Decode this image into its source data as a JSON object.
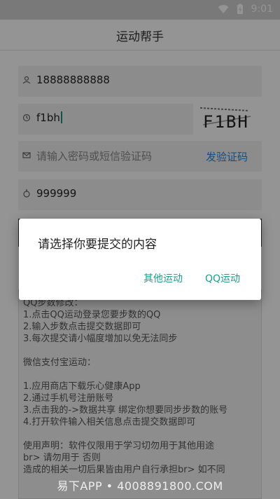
{
  "status_bar": {
    "time": "9:01"
  },
  "app_bar": {
    "title": "运动帮手"
  },
  "form": {
    "phone_value": "18888888888",
    "captcha_input_value": "f1bh",
    "captcha_image_text": "F1BH",
    "password_placeholder": "请输入密码或短信验证码",
    "send_code_label": "发验证码",
    "steps_value": "999999"
  },
  "info": {
    "lines": [
      "QQ步数修改：",
      "1.点击QQ运动登录您要步数的QQ",
      "2.输入步数点击提交数据即可",
      "3.每次提交请小幅度增加以免无法同步",
      "",
      "微信支付宝运动：",
      "",
      "1.应用商店下载乐心健康App",
      "2.通过手机号注册账号",
      "3.点击我的->数据共享 绑定你想要同步步数的账号",
      "4.打开软件输入相关信息点击提交数据即可",
      "",
      "使用声明：软件仅限用于学习切勿用于其他用途",
      "br> 请勿用于 否则",
      "造成的相关一切后果皆由用户自行承担br> 如不同"
    ]
  },
  "dialog": {
    "title": "请选择你要提交的内容",
    "btn_other": "其他运动",
    "btn_qq": "QQ运动"
  },
  "watermark": "易下APP • 4008891800.COM"
}
